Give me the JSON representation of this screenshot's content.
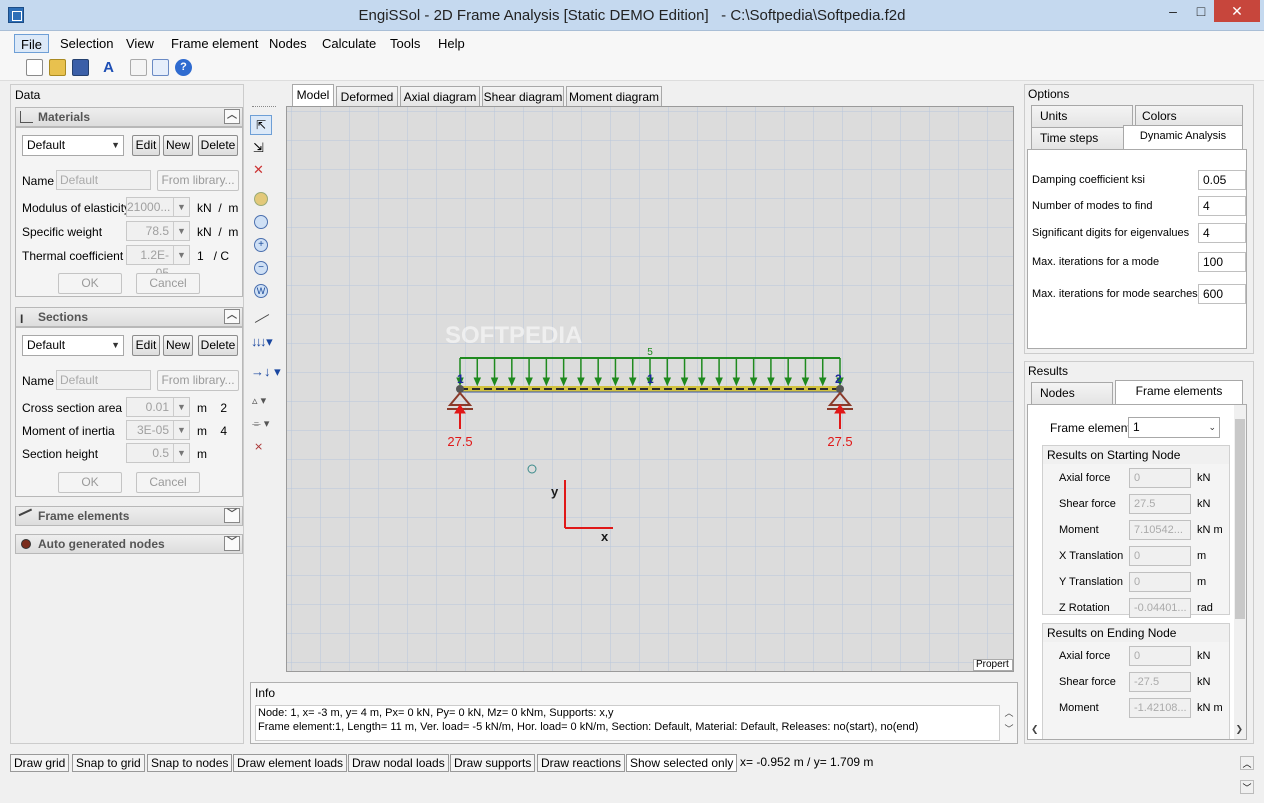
{
  "window": {
    "title": "EngiSSol - 2D Frame Analysis [Static DEMO Edition]   - C:\\Softpedia\\Softpedia.f2d",
    "min": "–",
    "max": "□",
    "close": "✕"
  },
  "menu": [
    "File",
    "Selection",
    "View",
    "Frame element",
    "Nodes",
    "Calculate",
    "Tools",
    "Help"
  ],
  "toolbar_icons": [
    "new-file-icon",
    "open-folder-icon",
    "save-icon",
    "font-icon",
    "chart-icon",
    "preview-icon",
    "help-icon"
  ],
  "left": {
    "panel_title": "Data",
    "materials": {
      "title": "Materials",
      "combo": "Default",
      "edit": "Edit",
      "new": "New",
      "delete": "Delete",
      "name_label": "Name",
      "name_value": "Default",
      "from_library": "From library...",
      "modulus_label": "Modulus of elasticity",
      "modulus_value": "21000...",
      "modulus_unit": "kN  /  m   2",
      "weight_label": "Specific weight",
      "weight_value": "78.5",
      "weight_unit": "kN  /  m   3",
      "thermal_label": "Thermal coefficient",
      "thermal_value": "1.2E-05",
      "thermal_unit": "1   / C",
      "ok": "OK",
      "cancel": "Cancel"
    },
    "sections": {
      "title": "Sections",
      "combo": "Default",
      "edit": "Edit",
      "new": "New",
      "delete": "Delete",
      "name_label": "Name",
      "name_value": "Default",
      "from_library": "From library...",
      "area_label": "Cross section area",
      "area_value": "0.01",
      "area_unit": "m    2",
      "inertia_label": "Moment of inertia",
      "inertia_value": "3E-05",
      "inertia_unit": "m    4",
      "height_label": "Section height",
      "height_value": "0.5",
      "height_unit": "m",
      "ok": "OK",
      "cancel": "Cancel"
    },
    "frame_elements": "Frame elements",
    "auto_nodes": "Auto generated nodes"
  },
  "tabs": [
    "Model",
    "Deformed",
    "Axial diagram",
    "Shear diagram",
    "Moment diagram"
  ],
  "canvas": {
    "load_value": "5",
    "node1": "1",
    "node2": "2",
    "element_label": "1",
    "reaction1": "27.5",
    "reaction2": "27.5",
    "axis_x": "x",
    "axis_y": "y",
    "properties_tab": "Propert",
    "watermark": "SOFTPEDIA"
  },
  "info": {
    "title": "Info",
    "line1": "Node: 1, x= -3 m, y= 4 m, Px= 0 kN, Py= 0 kN, Mz= 0 kNm, Supports: x,y",
    "line2": "Frame element:1, Length= 11 m, Ver. load= -5 kN/m, Hor. load= 0 kN/m, Section: Default, Material: Default, Releases: no(start), no(end)"
  },
  "status": {
    "buttons": [
      "Draw grid",
      "Snap to grid",
      "Snap to nodes",
      "Draw element loads",
      "Draw nodal loads",
      "Draw supports",
      "Draw reactions",
      "Show selected only"
    ],
    "coords": "x= -0.952 m / y= 1.709 m"
  },
  "options": {
    "title": "Options",
    "tabs": [
      "Units",
      "Colors",
      "Time steps",
      "Dynamic Analysis"
    ],
    "rows": [
      {
        "label": "Damping coefficient ksi",
        "value": "0.05"
      },
      {
        "label": "Number of modes to find",
        "value": "4"
      },
      {
        "label": "Significant digits for eigenvalues",
        "value": "4"
      },
      {
        "label": "Max. iterations for a mode",
        "value": "100"
      },
      {
        "label": "Max. iterations for mode searches",
        "value": "600"
      }
    ]
  },
  "results": {
    "title": "Results",
    "tabs": [
      "Nodes",
      "Frame elements"
    ],
    "frame_element_label": "Frame element",
    "frame_element_value": "1",
    "start_title": "Results on Starting Node",
    "start": [
      {
        "label": "Axial force",
        "value": "0",
        "unit": "kN"
      },
      {
        "label": "Shear force",
        "value": "27.5",
        "unit": "kN"
      },
      {
        "label": "Moment",
        "value": "7.10542...",
        "unit": "kN m"
      },
      {
        "label": "X Translation",
        "value": "0",
        "unit": "m"
      },
      {
        "label": "Y Translation",
        "value": "0",
        "unit": "m"
      },
      {
        "label": "Z Rotation",
        "value": "-0.04401...",
        "unit": "rad"
      }
    ],
    "end_title": "Results on Ending Node",
    "end": [
      {
        "label": "Axial force",
        "value": "0",
        "unit": "kN"
      },
      {
        "label": "Shear force",
        "value": "-27.5",
        "unit": "kN"
      },
      {
        "label": "Moment",
        "value": "-1.42108...",
        "unit": "kN m"
      }
    ]
  }
}
